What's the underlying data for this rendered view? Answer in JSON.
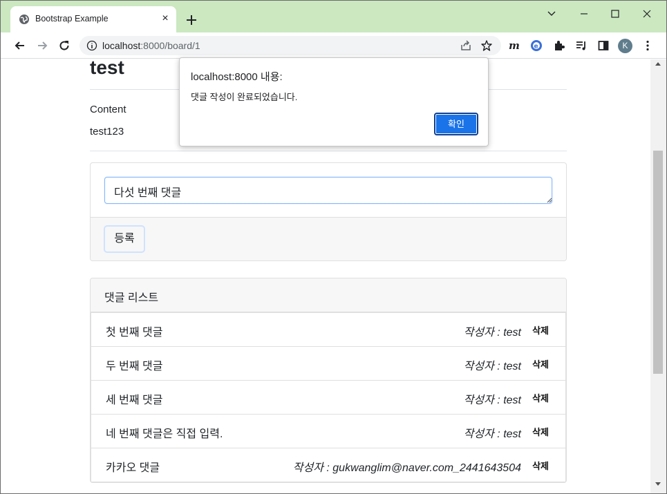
{
  "browser": {
    "tab_title": "Bootstrap Example",
    "tab_close": "×",
    "url_host": "localhost",
    "url_rest": ":8000/board/1",
    "profile_initial": "K"
  },
  "post": {
    "title": "test",
    "content_label": "Content",
    "content_text": "test123"
  },
  "comment_form": {
    "input_value": "다섯 번째 댓글",
    "submit_label": "등록"
  },
  "comment_list": {
    "header": "댓글 리스트",
    "delete_label": "삭제",
    "items": [
      {
        "text": "첫 번째 댓글",
        "author": "작성자 : test"
      },
      {
        "text": "두 번째 댓글",
        "author": "작성자 : test"
      },
      {
        "text": "세 번째 댓글",
        "author": "작성자 : test"
      },
      {
        "text": "네 번째 댓글은 직접 입력.",
        "author": "작성자 : test"
      },
      {
        "text": "카카오 댓글",
        "author": "작성자 : gukwanglim@naver.com_2441643504"
      }
    ]
  },
  "alert": {
    "title": "localhost:8000 내용:",
    "message": "댓글 작성이 완료되었습니다.",
    "ok_label": "확인"
  },
  "colors": {
    "tabstrip": "#cbe8c1",
    "accent": "#1a73e8"
  }
}
